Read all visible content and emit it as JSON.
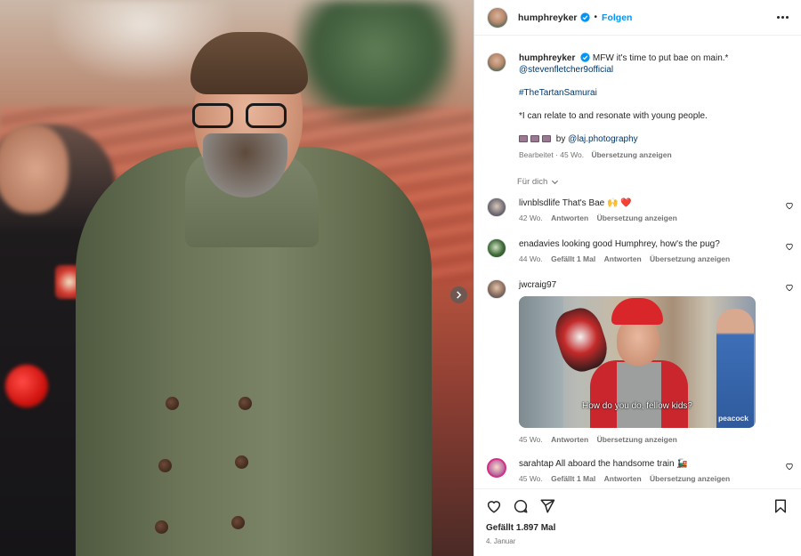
{
  "post": {
    "author": "humphreyker",
    "follow_label": "Folgen",
    "dot": "•"
  },
  "caption": {
    "username": "humphreyker",
    "text": "MFW it's time to put bae on main.*",
    "mention": "@stevenfletcher9official",
    "hashtag": "#TheTartanSamurai",
    "footnote": "*I can relate to and resonate with young people.",
    "credit_prefix": "by",
    "credit_link": "@laj.photography",
    "meta_edited": "Bearbeitet · 45 Wo.",
    "meta_translate": "Übersetzung anzeigen"
  },
  "for_you_label": "Für dich",
  "comments": [
    {
      "user": "livnblsdlife",
      "text": "That's Bae 🙌 ❤️",
      "age": "42 Wo.",
      "likes": "",
      "reply": "Antworten",
      "translate": "Übersetzung anzeigen"
    },
    {
      "user": "enadavies",
      "text": "looking good Humphrey, how's the pug?",
      "age": "44 Wo.",
      "likes": "Gefällt 1 Mal",
      "reply": "Antworten",
      "translate": "Übersetzung anzeigen"
    },
    {
      "user": "jwcraig97",
      "text": "",
      "gif_subtitle": "How do you do, fellow kids?",
      "gif_watermark": "peacock",
      "age": "45 Wo.",
      "likes": "",
      "reply": "Antworten",
      "translate": "Übersetzung anzeigen"
    },
    {
      "user": "sarahtap",
      "text": "All aboard the handsome train 🚂",
      "age": "45 Wo.",
      "likes": "Gefällt 1 Mal",
      "reply": "Antworten",
      "translate": "Übersetzung anzeigen"
    }
  ],
  "footer": {
    "likes": "Gefällt 1.897 Mal",
    "date": "4. Januar"
  },
  "icons": {
    "verified": "verified-badge-icon",
    "more": "more-options-icon",
    "like": "heart-icon",
    "comment": "comment-icon",
    "share": "share-icon",
    "save": "bookmark-icon",
    "next": "chevron-right-icon"
  },
  "colors": {
    "link": "#00376b",
    "follow": "#0095f6",
    "muted": "#737373",
    "verified": "#0095f6"
  }
}
